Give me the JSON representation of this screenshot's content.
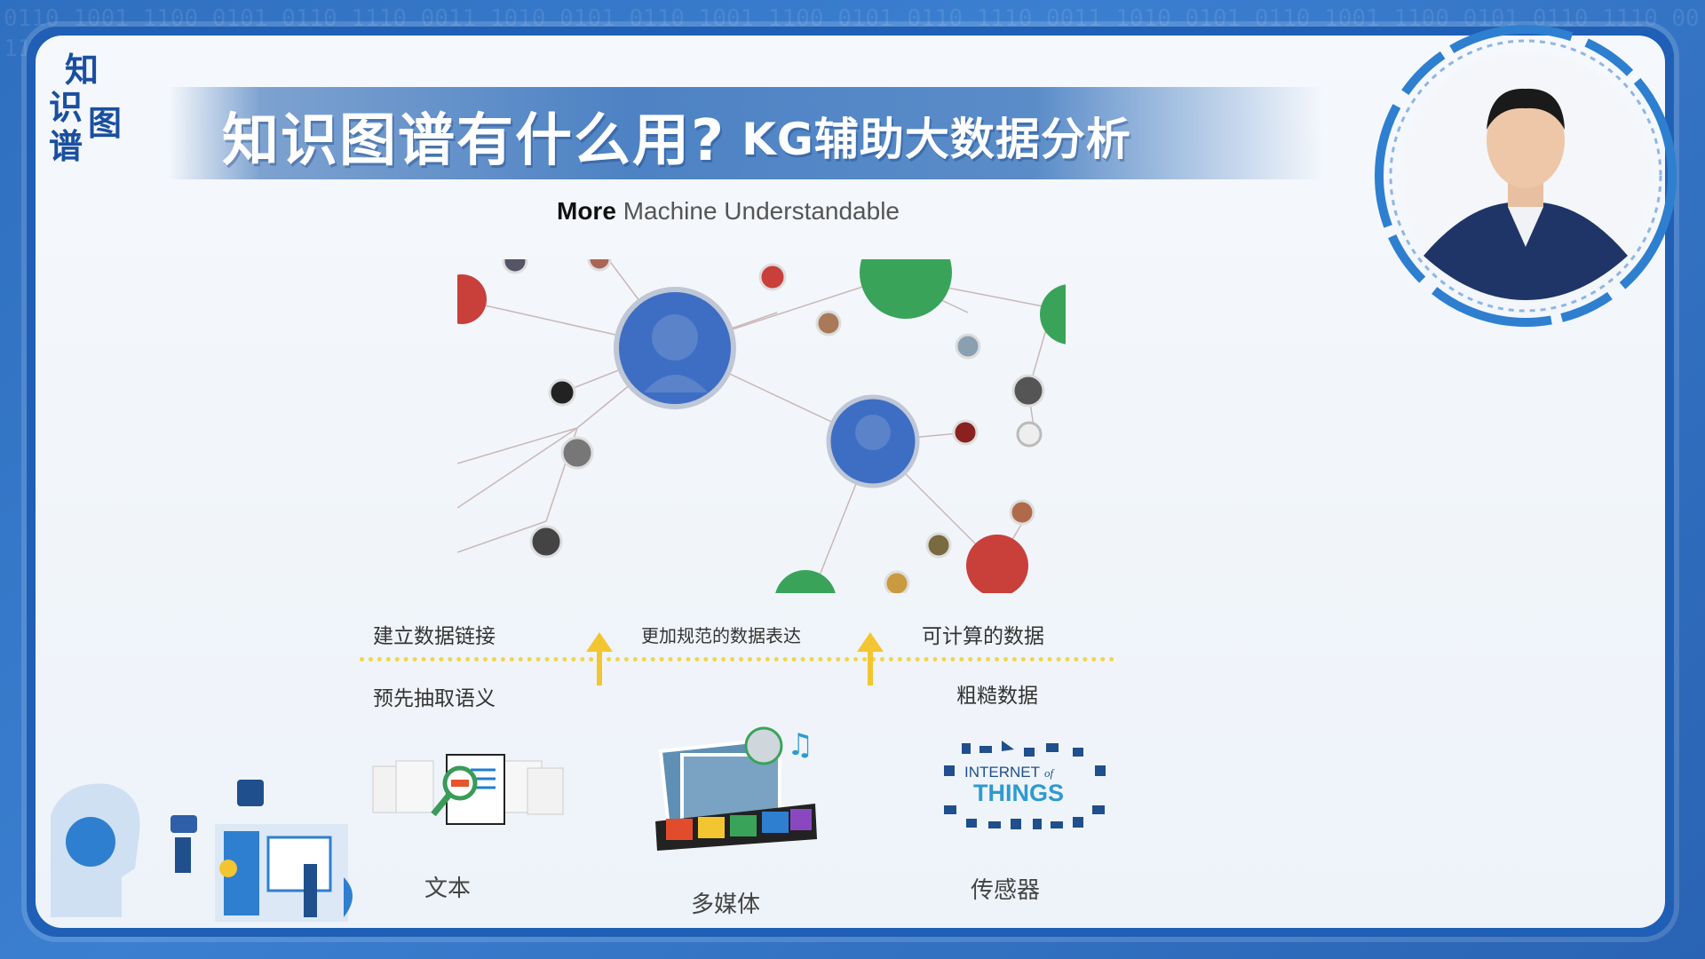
{
  "logo": {
    "chars": [
      "知",
      "识",
      "图",
      "谱"
    ]
  },
  "title": {
    "main": "知识图谱有什么用?",
    "sub": "KG辅助大数据分析"
  },
  "subtitle": {
    "bold": "More",
    "rest": "Machine Understandable"
  },
  "layers": {
    "upper": [
      "建立数据链接",
      "更加规范的数据表达",
      "可计算的数据"
    ],
    "lower": [
      "预先抽取语义",
      "粗糙数据"
    ]
  },
  "sources": [
    {
      "label": "文本",
      "icon": "text-document-search-icon"
    },
    {
      "label": "多媒体",
      "icon": "multimedia-filmstrip-icon"
    },
    {
      "label": "传感器",
      "icon": "internet-of-things-icon"
    }
  ],
  "iot": {
    "line1": "INTERNET",
    "of": "of",
    "line2": "THINGS"
  },
  "colors": {
    "accent": "#1f5fb5",
    "arrow": "#f3c531",
    "title_text": "#ffffff"
  }
}
